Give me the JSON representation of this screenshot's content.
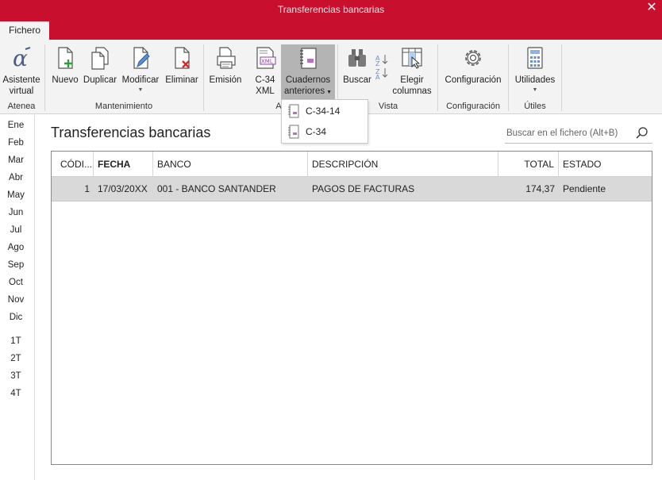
{
  "window": {
    "title": "Transferencias bancarias",
    "close_glyph": "✕"
  },
  "tabs": [
    {
      "label": "Fichero"
    }
  ],
  "ribbon": {
    "atenea": {
      "group_label": "Atenea",
      "asistente": {
        "label1": "Asistente",
        "label2": "virtual",
        "icon": "alpha-icon"
      }
    },
    "mantenimiento": {
      "group_label": "Mantenimiento",
      "nuevo": {
        "label": "Nuevo",
        "icon": "new-document-icon"
      },
      "duplicar": {
        "label": "Duplicar",
        "icon": "duplicate-icon"
      },
      "modificar": {
        "label": "Modificar",
        "icon": "edit-document-icon"
      },
      "eliminar": {
        "label": "Eliminar",
        "icon": "delete-document-icon"
      }
    },
    "archivos": {
      "group_label": "A",
      "emision": {
        "label": "Emisión",
        "icon": "printer-icon"
      },
      "c34xml": {
        "label1": "C-34",
        "label2": "XML",
        "icon": "xml-file-icon"
      },
      "cuadernos": {
        "label1": "Cuadernos",
        "label2": "anteriores",
        "icon": "notebook-icon"
      }
    },
    "vista": {
      "group_label": "Vista",
      "buscar": {
        "label": "Buscar",
        "icon": "binoculars-icon"
      },
      "sort": {
        "icon": "sort-az-icon"
      },
      "elegir": {
        "label1": "Elegir",
        "label2": "columnas",
        "icon": "columns-icon"
      }
    },
    "configuracion": {
      "group_label": "Configuración",
      "config": {
        "label": "Configuración",
        "icon": "gear-icon"
      }
    },
    "utiles": {
      "group_label": "Útiles",
      "utilidades": {
        "label": "Utilidades",
        "icon": "calculator-icon"
      }
    }
  },
  "dropdown": {
    "items": [
      {
        "label": "C-34-14"
      },
      {
        "label": "C-34"
      }
    ]
  },
  "months": [
    "Ene",
    "Feb",
    "Mar",
    "Abr",
    "May",
    "Jun",
    "Jul",
    "Ago",
    "Sep",
    "Oct",
    "Nov",
    "Dic"
  ],
  "quarters": [
    "1T",
    "2T",
    "3T",
    "4T"
  ],
  "page": {
    "title": "Transferencias bancarias"
  },
  "search": {
    "placeholder": "Buscar en el fichero (Alt+B)"
  },
  "table": {
    "columns": [
      "CÓDI...",
      "FECHA",
      "BANCO",
      "DESCRIPCIÓN",
      "TOTAL",
      "ESTADO"
    ],
    "rows": [
      {
        "codigo": "1",
        "fecha": "17/03/20XX",
        "banco": "001 - BANCO SANTANDER",
        "descripcion": "PAGOS DE FACTURAS",
        "total": "174,37",
        "estado": "Pendiente"
      }
    ]
  },
  "colors": {
    "brand": "#c8102e",
    "ribbon_bg": "#f3f3f3",
    "selected_row": "#d9d9d9",
    "green": "#2e9e3a",
    "red": "#d9262b"
  }
}
